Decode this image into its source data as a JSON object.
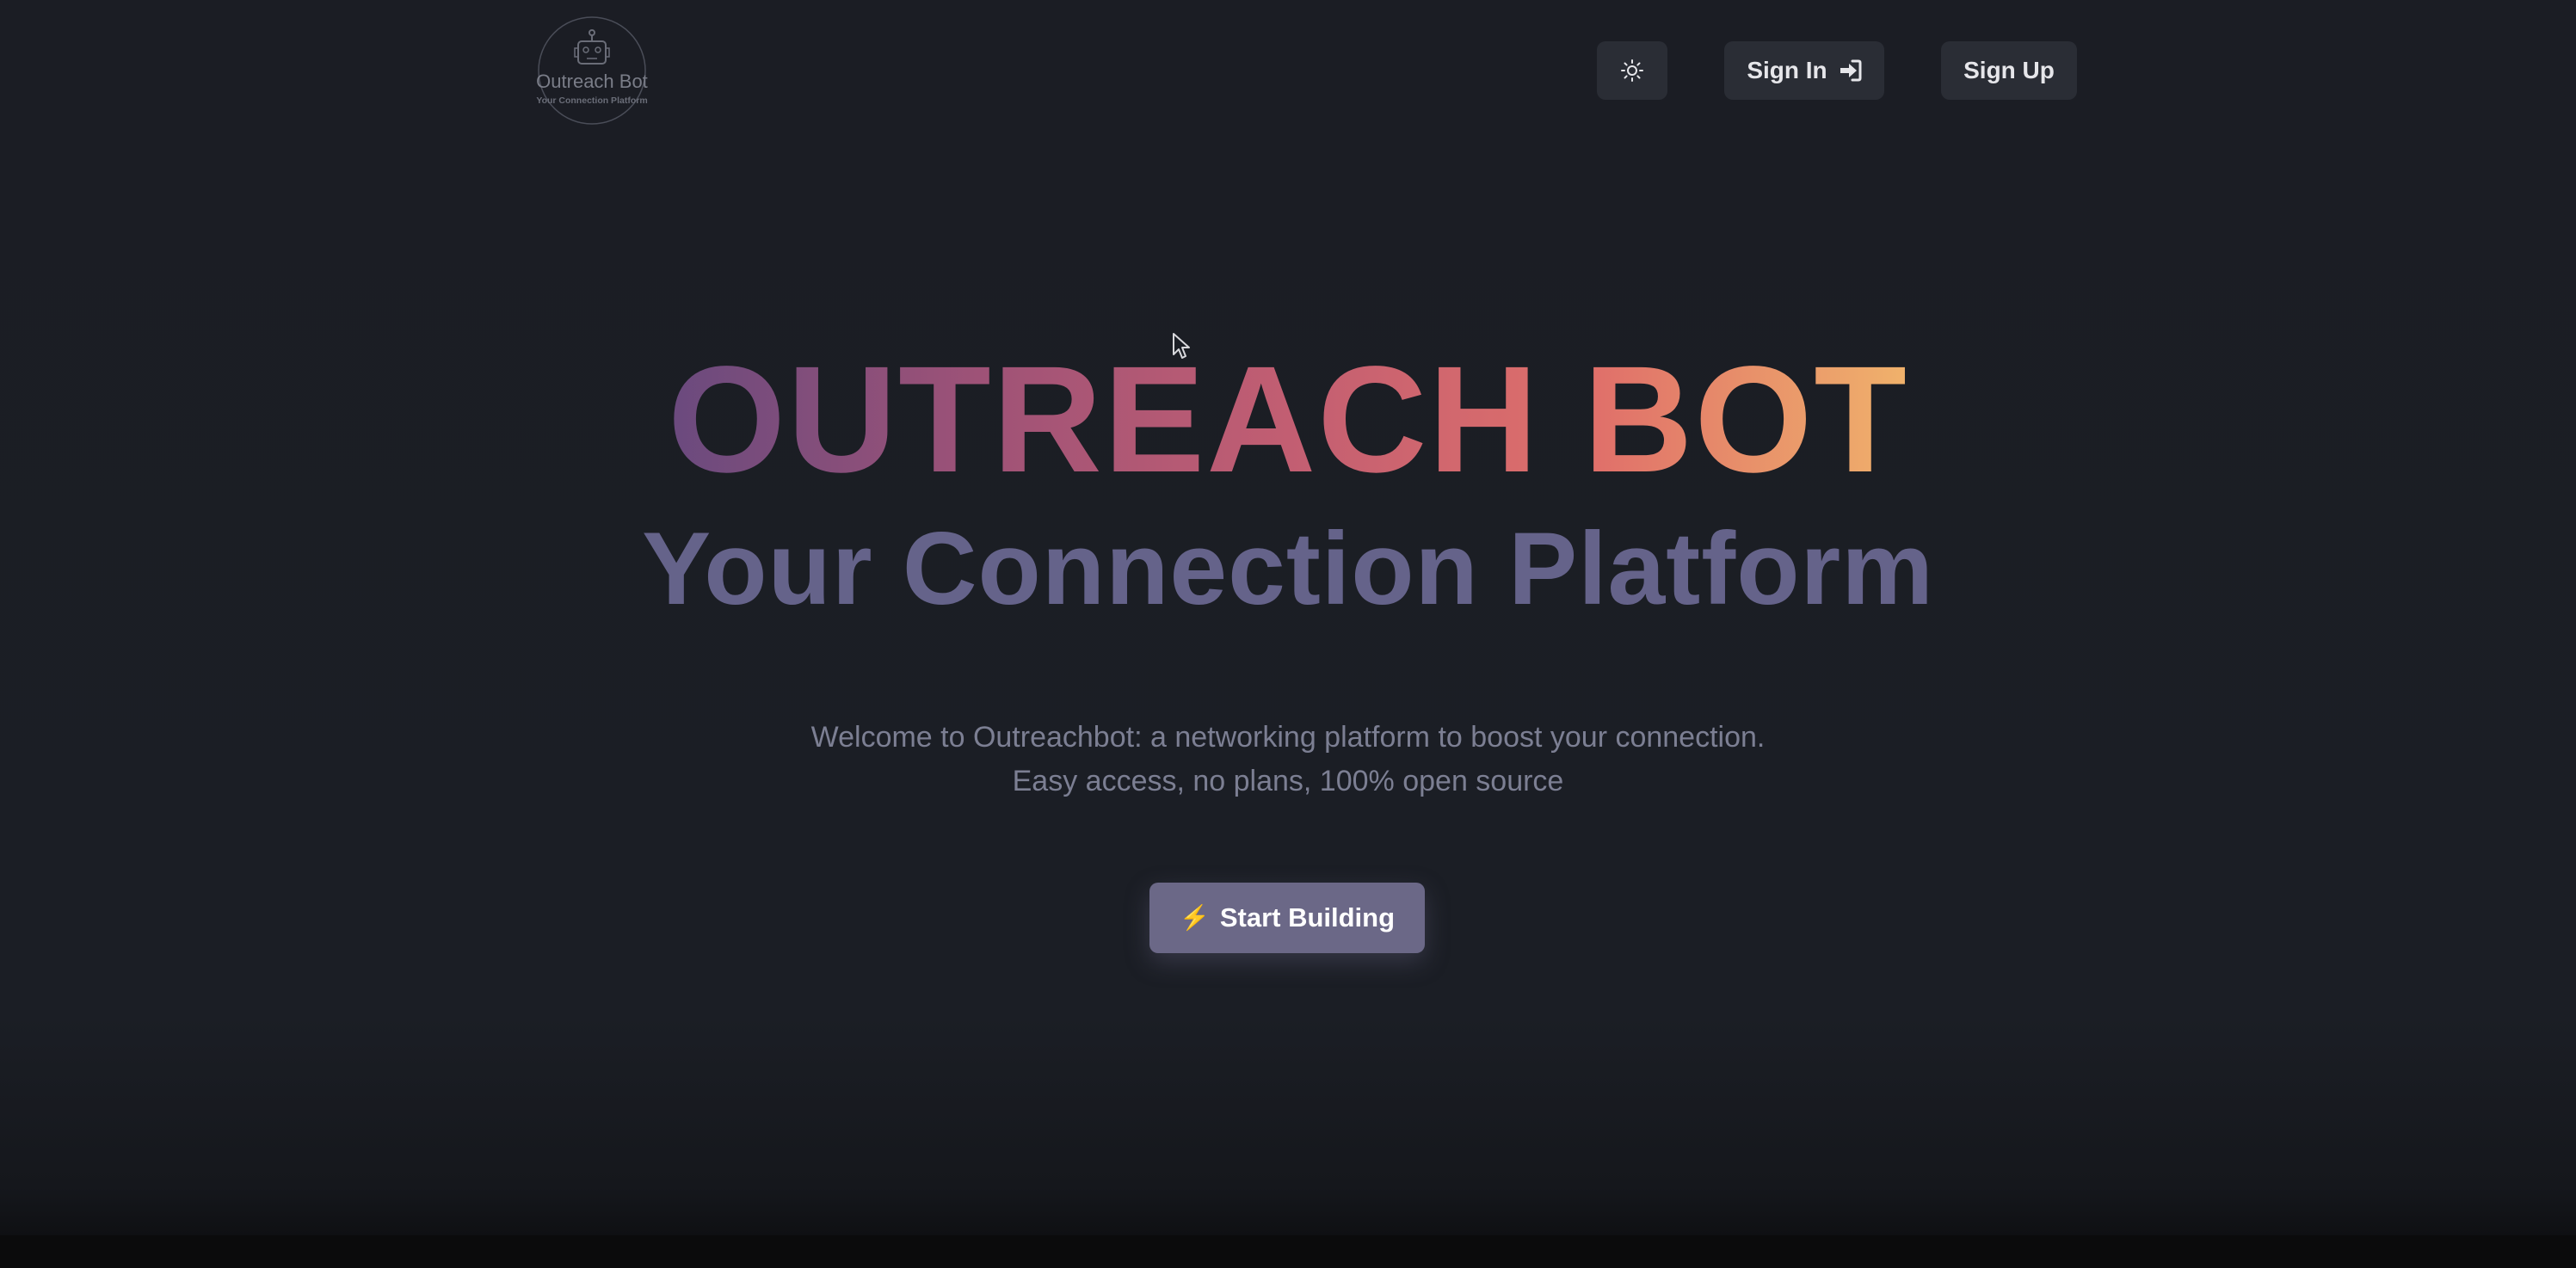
{
  "brand": {
    "logo_name": "Outreach Bot",
    "logo_tagline": "Your Connection Platform"
  },
  "header": {
    "theme_toggle_icon": "sun-icon",
    "sign_in_label": "Sign In",
    "sign_in_icon": "sign-in-icon",
    "sign_up_label": "Sign Up"
  },
  "hero": {
    "title": "OUTREACH BOT",
    "subtitle": "Your Connection Platform",
    "description_line1": "Welcome to Outreachbot: a networking platform to boost your connection.",
    "description_line2": "Easy access, no plans, 100% open source",
    "cta_icon": "⚡",
    "cta_label": "Start Building"
  },
  "colors": {
    "background": "#1b1e25",
    "button_bg": "#2a2d35",
    "cta_bg": "#6b6887",
    "subtitle": "#65638a",
    "gradient_start": "#6a4a7e",
    "gradient_end": "#f0b26b"
  }
}
